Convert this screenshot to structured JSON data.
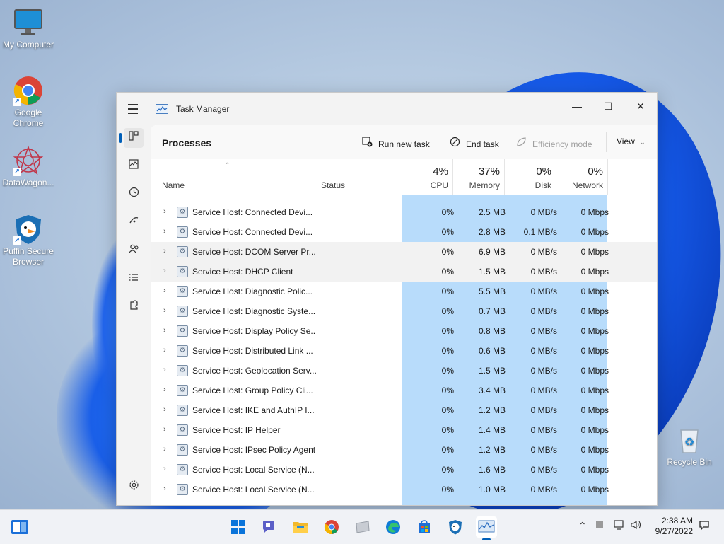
{
  "desktop": {
    "icons": [
      {
        "label": "My Computer"
      },
      {
        "label": "Google Chrome"
      },
      {
        "label": "DataWagon..."
      },
      {
        "label": "Puffin Secure Browser"
      },
      {
        "label": "Recycle Bin"
      }
    ]
  },
  "window": {
    "title": "Task Manager",
    "controls": {
      "minimize": "—",
      "maximize": "☐",
      "close": "✕"
    }
  },
  "toolbar": {
    "page_title": "Processes",
    "run_new_task": "Run new task",
    "end_task": "End task",
    "efficiency_mode": "Efficiency mode",
    "view": "View"
  },
  "columns": {
    "name": "Name",
    "status": "Status",
    "cpu": {
      "pct": "4%",
      "label": "CPU"
    },
    "memory": {
      "pct": "37%",
      "label": "Memory"
    },
    "disk": {
      "pct": "0%",
      "label": "Disk"
    },
    "network": {
      "pct": "0%",
      "label": "Network"
    }
  },
  "processes": [
    {
      "name": "Service Host: Connected Devi...",
      "cpu": "0%",
      "memory": "2.5 MB",
      "disk": "0 MB/s",
      "network": "0 Mbps"
    },
    {
      "name": "Service Host: Connected Devi...",
      "cpu": "0%",
      "memory": "2.8 MB",
      "disk": "0.1 MB/s",
      "network": "0 Mbps"
    },
    {
      "name": "Service Host: DCOM Server Pr...",
      "cpu": "0%",
      "memory": "6.9 MB",
      "disk": "0 MB/s",
      "network": "0 Mbps"
    },
    {
      "name": "Service Host: DHCP Client",
      "cpu": "0%",
      "memory": "1.5 MB",
      "disk": "0 MB/s",
      "network": "0 Mbps"
    },
    {
      "name": "Service Host: Diagnostic Polic...",
      "cpu": "0%",
      "memory": "5.5 MB",
      "disk": "0 MB/s",
      "network": "0 Mbps"
    },
    {
      "name": "Service Host: Diagnostic Syste...",
      "cpu": "0%",
      "memory": "0.7 MB",
      "disk": "0 MB/s",
      "network": "0 Mbps"
    },
    {
      "name": "Service Host: Display Policy Se...",
      "cpu": "0%",
      "memory": "0.8 MB",
      "disk": "0 MB/s",
      "network": "0 Mbps"
    },
    {
      "name": "Service Host: Distributed Link ...",
      "cpu": "0%",
      "memory": "0.6 MB",
      "disk": "0 MB/s",
      "network": "0 Mbps"
    },
    {
      "name": "Service Host: Geolocation Serv...",
      "cpu": "0%",
      "memory": "1.5 MB",
      "disk": "0 MB/s",
      "network": "0 Mbps"
    },
    {
      "name": "Service Host: Group Policy Cli...",
      "cpu": "0%",
      "memory": "3.4 MB",
      "disk": "0 MB/s",
      "network": "0 Mbps"
    },
    {
      "name": "Service Host: IKE and AuthIP I...",
      "cpu": "0%",
      "memory": "1.2 MB",
      "disk": "0 MB/s",
      "network": "0 Mbps"
    },
    {
      "name": "Service Host: IP Helper",
      "cpu": "0%",
      "memory": "1.4 MB",
      "disk": "0 MB/s",
      "network": "0 Mbps"
    },
    {
      "name": "Service Host: IPsec Policy Agent",
      "cpu": "0%",
      "memory": "1.2 MB",
      "disk": "0 MB/s",
      "network": "0 Mbps"
    },
    {
      "name": "Service Host: Local Service (N...",
      "cpu": "0%",
      "memory": "1.6 MB",
      "disk": "0 MB/s",
      "network": "0 Mbps"
    },
    {
      "name": "Service Host: Local Service (N...",
      "cpu": "0%",
      "memory": "1.0 MB",
      "disk": "0 MB/s",
      "network": "0 Mbps"
    }
  ],
  "taskbar": {
    "time": "2:38 AM",
    "date": "9/27/2022",
    "apps": [
      "start-icon",
      "widgets-icon",
      "chat-icon",
      "file-explorer-icon",
      "chrome-icon",
      "app-icon",
      "edge-icon",
      "store-icon",
      "puffin-icon",
      "task-manager-icon"
    ]
  },
  "colors": {
    "accent": "#005fb8",
    "highlight_column": "#b8dcfb",
    "taskbar": "#f0f2f6"
  }
}
